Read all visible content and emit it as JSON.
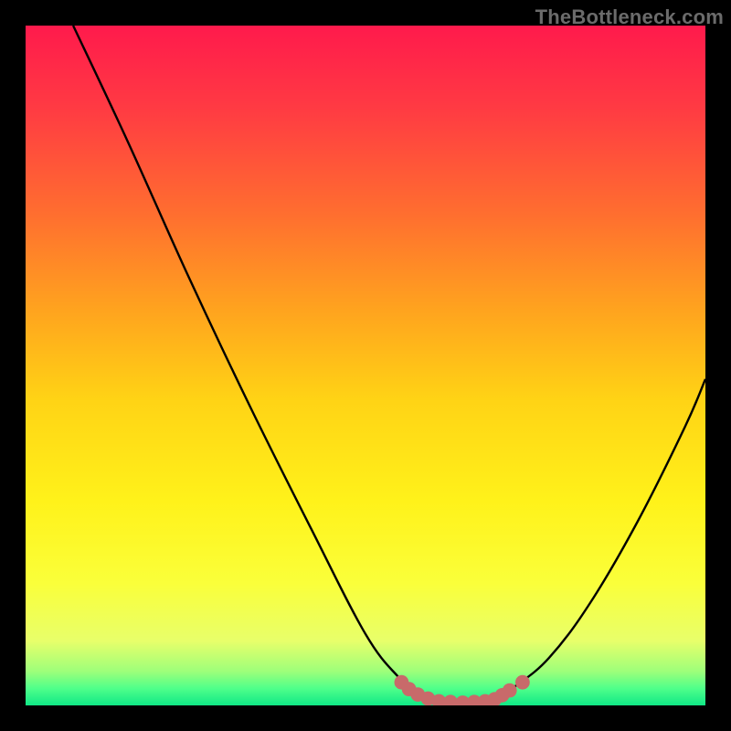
{
  "watermark": "TheBottleneck.com",
  "colors": {
    "frame": "#000000",
    "gradient_stops": [
      {
        "offset": 0.0,
        "hex": "#ff1a4c"
      },
      {
        "offset": 0.12,
        "hex": "#ff3a43"
      },
      {
        "offset": 0.28,
        "hex": "#ff6f2f"
      },
      {
        "offset": 0.42,
        "hex": "#ffa41e"
      },
      {
        "offset": 0.55,
        "hex": "#ffd315"
      },
      {
        "offset": 0.7,
        "hex": "#fff21a"
      },
      {
        "offset": 0.82,
        "hex": "#faff3a"
      },
      {
        "offset": 0.905,
        "hex": "#e8ff6a"
      },
      {
        "offset": 0.95,
        "hex": "#9dff7a"
      },
      {
        "offset": 0.975,
        "hex": "#4fff8a"
      },
      {
        "offset": 1.0,
        "hex": "#10e886"
      }
    ],
    "curve": "#000000",
    "marker_stroke": "#c86a6a",
    "marker_fill": "#c86a6a"
  },
  "chart_data": {
    "type": "line",
    "title": "",
    "xlabel": "",
    "ylabel": "",
    "xlim": [
      0,
      100
    ],
    "ylim": [
      0,
      100
    ],
    "series": [
      {
        "name": "bottleneck-curve",
        "points": [
          {
            "x": 7.0,
            "y": 100.0
          },
          {
            "x": 15.0,
            "y": 83.0
          },
          {
            "x": 24.0,
            "y": 63.0
          },
          {
            "x": 33.0,
            "y": 44.0
          },
          {
            "x": 42.0,
            "y": 26.0
          },
          {
            "x": 50.0,
            "y": 10.5
          },
          {
            "x": 55.0,
            "y": 4.0
          },
          {
            "x": 58.0,
            "y": 1.4
          },
          {
            "x": 61.0,
            "y": 0.5
          },
          {
            "x": 65.0,
            "y": 0.4
          },
          {
            "x": 69.0,
            "y": 0.9
          },
          {
            "x": 72.0,
            "y": 2.8
          },
          {
            "x": 77.0,
            "y": 7.0
          },
          {
            "x": 83.0,
            "y": 15.0
          },
          {
            "x": 90.0,
            "y": 27.0
          },
          {
            "x": 97.0,
            "y": 41.0
          },
          {
            "x": 100.0,
            "y": 48.0
          }
        ]
      }
    ],
    "markers": {
      "name": "highlight-segment",
      "points": [
        {
          "x": 55.3,
          "y": 3.4
        },
        {
          "x": 56.4,
          "y": 2.4
        },
        {
          "x": 57.7,
          "y": 1.6
        },
        {
          "x": 59.2,
          "y": 1.0
        },
        {
          "x": 60.8,
          "y": 0.6
        },
        {
          "x": 62.5,
          "y": 0.5
        },
        {
          "x": 64.3,
          "y": 0.4
        },
        {
          "x": 66.0,
          "y": 0.5
        },
        {
          "x": 67.6,
          "y": 0.6
        },
        {
          "x": 69.0,
          "y": 0.9
        },
        {
          "x": 70.1,
          "y": 1.5
        },
        {
          "x": 71.2,
          "y": 2.2
        },
        {
          "x": 73.1,
          "y": 3.4
        }
      ]
    }
  }
}
